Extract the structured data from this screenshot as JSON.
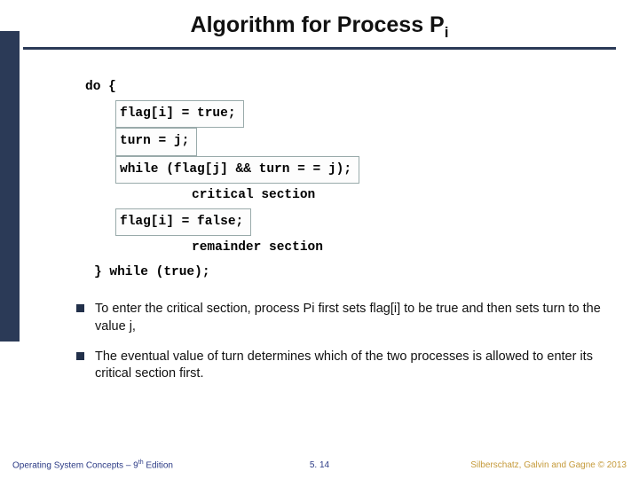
{
  "title": {
    "main": "Algorithm for Process P",
    "sub": "i"
  },
  "code": {
    "do_open": "do {",
    "flag_set": "flag[i] = true;",
    "turn_set": "turn = j;",
    "while_cond": "while (flag[j] && turn = = j);",
    "critical": "critical section",
    "flag_reset": "flag[i] = false;",
    "remainder": "remainder section",
    "close": "} while (true);"
  },
  "bullets": [
    "To enter the critical section, process Pi first sets flag[i] to be true and then sets turn to the value j,",
    "The eventual value of turn determines which of the two processes is allowed to enter its critical section first."
  ],
  "footer": {
    "left_a": "Operating System Concepts – 9",
    "left_sup": "th",
    "left_b": " Edition",
    "center": "5. 14",
    "right": "Silberschatz, Galvin and Gagne © 2013"
  }
}
